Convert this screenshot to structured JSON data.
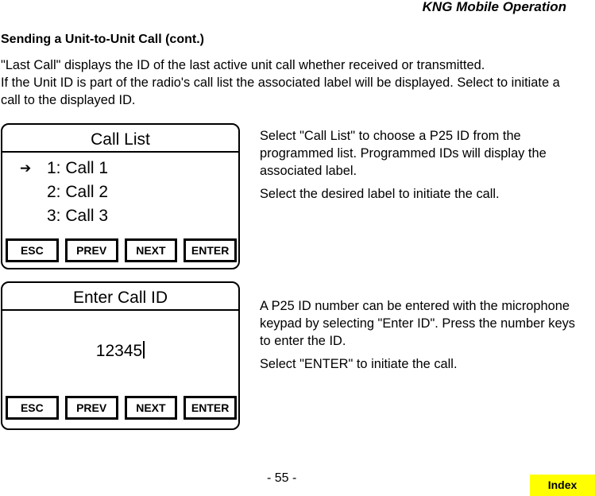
{
  "header": {
    "section": "KNG Mobile Operation"
  },
  "title": "Sending a Unit-to-Unit Call (cont.)",
  "intro": {
    "line1": "\"Last Call\" displays the ID of the last active unit call whether received or transmitted.",
    "line2": "If the Unit ID is part of the radio's call list the associated label will be displayed. Select to initiate a call to the displayed ID."
  },
  "screen1": {
    "title": "Call List",
    "items": [
      "1: Call 1",
      "2: Call 2",
      "3: Call 3"
    ],
    "selected_index": 0,
    "selector_icon": "arrow-right-icon",
    "softkeys": [
      "ESC",
      "PREV",
      "NEXT",
      "ENTER"
    ]
  },
  "desc1": {
    "p1": "Select \"Call List\" to choose a P25 ID from the programmed list. Programmed IDs will display the associated label.",
    "p2": "Select the desired label to initiate the call."
  },
  "screen2": {
    "title": "Enter Call ID",
    "value": "12345",
    "softkeys": [
      "ESC",
      "PREV",
      "NEXT",
      "ENTER"
    ]
  },
  "desc2": {
    "p1": "A P25 ID number can be entered with the microphone keypad by selecting \"Enter ID\". Press the number keys to enter the ID.",
    "p2": "Select \"ENTER\" to initiate the call."
  },
  "footer": {
    "page_number": "- 55 -",
    "index_label": "Index",
    "index_color": "#ffff00"
  }
}
